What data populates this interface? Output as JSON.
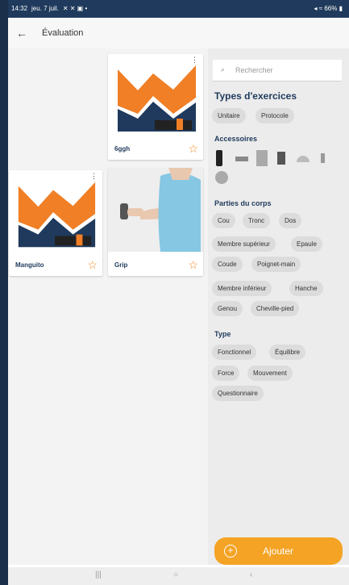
{
  "status_bar": {
    "time": "14:32",
    "date": "jeu. 7 juil.",
    "right": "66%"
  },
  "appbar": {
    "title": "Évaluation"
  },
  "cards": [
    {
      "label": "6ggh"
    },
    {
      "label": "Manguito"
    },
    {
      "label": "Grip"
    }
  ],
  "search": {
    "placeholder": "Rechercher"
  },
  "sections": {
    "types_title": "Types d'exercices",
    "types": [
      "Unitaire",
      "Protocole"
    ],
    "accessories_title": "Accessoires",
    "body_title": "Parties du corps",
    "body_parts": [
      "Cou",
      "Tronc",
      "Dos",
      "Membre supérieur",
      "Epaule",
      "Coude",
      "Poignet-main",
      "Membre inférieur",
      "Hanche",
      "Genou",
      "Cheville-pied"
    ],
    "type_title": "Type",
    "types2": [
      "Fonctionnel",
      "Équilibre",
      "Force",
      "Mouvement",
      "Questionnaire"
    ]
  },
  "button": {
    "add": "Ajouter"
  },
  "colors": {
    "accent": "#f4a324",
    "navy": "#1f3a5c",
    "logo_orange": "#f07f26"
  },
  "icons": [
    "back-arrow-icon",
    "search-icon",
    "star-icon",
    "plus-circle-icon",
    "more-vert-icon"
  ]
}
